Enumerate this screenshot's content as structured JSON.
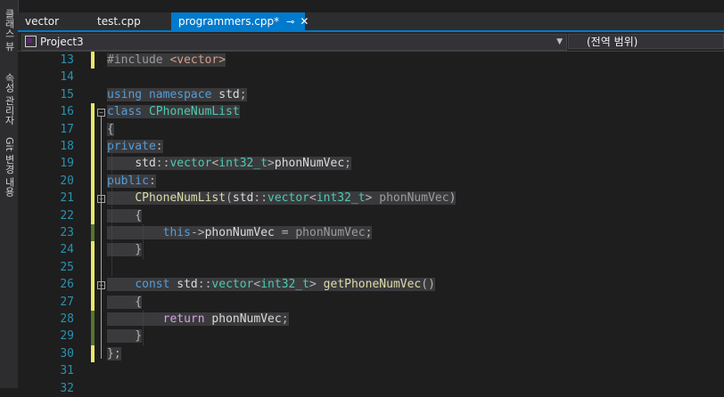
{
  "side_tabs": [
    "클래스 뷰",
    "속성 관리자",
    "Git 변경 내용"
  ],
  "tabs": [
    {
      "label": "vector",
      "active": false
    },
    {
      "label": "test.cpp",
      "active": false
    },
    {
      "label": "programmers.cpp*",
      "active": true
    }
  ],
  "nav": {
    "project": "Project3",
    "scope": "(전역 범위)"
  },
  "code": [
    {
      "num": "13",
      "bar": "yellow",
      "segs": [
        [
          "pp",
          "#include "
        ],
        [
          "inc",
          "<vector>"
        ]
      ]
    },
    {
      "num": "14",
      "bar": "",
      "segs": []
    },
    {
      "num": "15",
      "bar": "",
      "segs": [
        [
          "kw",
          "using"
        ],
        [
          "pu",
          " "
        ],
        [
          "kw",
          "namespace"
        ],
        [
          "pu",
          " "
        ],
        [
          "va",
          "std"
        ],
        [
          "pu",
          ";"
        ]
      ]
    },
    {
      "num": "16",
      "bar": "yellow",
      "segs": [
        [
          "kw",
          "class"
        ],
        [
          "pu",
          " "
        ],
        [
          "ty",
          "CPhoneNumList"
        ]
      ]
    },
    {
      "num": "17",
      "bar": "yellow",
      "segs": [
        [
          "pu",
          "{"
        ]
      ]
    },
    {
      "num": "18",
      "bar": "yellow",
      "segs": [
        [
          "kw",
          "private"
        ],
        [
          "pu",
          ":"
        ]
      ]
    },
    {
      "num": "19",
      "bar": "yellow",
      "segs": [
        [
          "pu",
          "    "
        ],
        [
          "va",
          "std"
        ],
        [
          "pu",
          "::"
        ],
        [
          "ty",
          "vector"
        ],
        [
          "pu",
          "<"
        ],
        [
          "ty",
          "int32_t"
        ],
        [
          "pu",
          ">"
        ],
        [
          "me",
          "phonNumVec"
        ],
        [
          "pu",
          ";"
        ]
      ]
    },
    {
      "num": "20",
      "bar": "yellow",
      "segs": [
        [
          "kw",
          "public"
        ],
        [
          "pu",
          ":"
        ]
      ]
    },
    {
      "num": "21",
      "bar": "yellow",
      "segs": [
        [
          "pu",
          "    "
        ],
        [
          "fn",
          "CPhoneNumList"
        ],
        [
          "pu",
          "("
        ],
        [
          "va",
          "std"
        ],
        [
          "pu",
          "::"
        ],
        [
          "ty",
          "vector"
        ],
        [
          "pu",
          "<"
        ],
        [
          "ty",
          "int32_t"
        ],
        [
          "pu",
          "> "
        ],
        [
          "pr",
          "phonNumVec"
        ],
        [
          "pu",
          ")"
        ]
      ]
    },
    {
      "num": "22",
      "bar": "yellow",
      "segs": [
        [
          "pu",
          "    {"
        ]
      ]
    },
    {
      "num": "23",
      "bar": "green",
      "segs": [
        [
          "pu",
          "        "
        ],
        [
          "kw",
          "this"
        ],
        [
          "pu",
          "->"
        ],
        [
          "me",
          "phonNumVec"
        ],
        [
          "pu",
          " = "
        ],
        [
          "pr",
          "phonNumVec"
        ],
        [
          "pu",
          ";"
        ]
      ]
    },
    {
      "num": "24",
      "bar": "yellow",
      "segs": [
        [
          "pu",
          "    }"
        ]
      ]
    },
    {
      "num": "25",
      "bar": "yellow",
      "segs": []
    },
    {
      "num": "26",
      "bar": "yellow",
      "segs": [
        [
          "pu",
          "    "
        ],
        [
          "kw",
          "const"
        ],
        [
          "pu",
          " "
        ],
        [
          "va",
          "std"
        ],
        [
          "pu",
          "::"
        ],
        [
          "ty",
          "vector"
        ],
        [
          "pu",
          "<"
        ],
        [
          "ty",
          "int32_t"
        ],
        [
          "pu",
          "> "
        ],
        [
          "fn",
          "getPhoneNumVec"
        ],
        [
          "pu",
          "()"
        ]
      ]
    },
    {
      "num": "27",
      "bar": "yellow",
      "segs": [
        [
          "pu",
          "    {"
        ]
      ]
    },
    {
      "num": "28",
      "bar": "green",
      "segs": [
        [
          "pu",
          "        "
        ],
        [
          "ctl",
          "return"
        ],
        [
          "pu",
          " "
        ],
        [
          "me",
          "phonNumVec"
        ],
        [
          "pu",
          ";"
        ]
      ]
    },
    {
      "num": "29",
      "bar": "green",
      "segs": [
        [
          "pu",
          "    }"
        ]
      ]
    },
    {
      "num": "30",
      "bar": "yellow",
      "segs": [
        [
          "pu",
          "};"
        ]
      ]
    },
    {
      "num": "31",
      "bar": "",
      "segs": []
    },
    {
      "num": "32",
      "bar": "",
      "segs": []
    }
  ],
  "colors": {
    "accent": "#007acc",
    "change_yellow": "#e8e86a",
    "change_green": "#577430"
  }
}
